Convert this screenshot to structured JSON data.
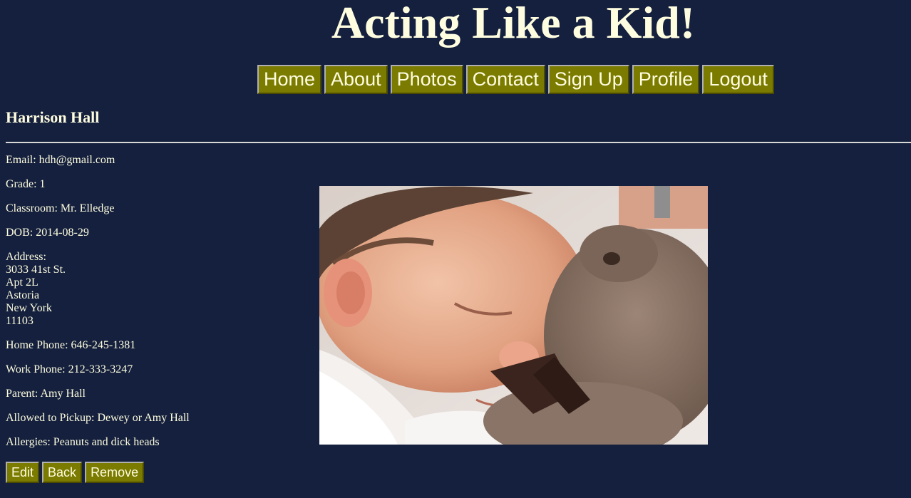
{
  "site": {
    "title": "Acting Like a Kid!"
  },
  "nav": {
    "items": [
      {
        "label": "Home"
      },
      {
        "label": "About"
      },
      {
        "label": "Photos"
      },
      {
        "label": "Contact"
      },
      {
        "label": "Sign Up"
      },
      {
        "label": "Profile"
      },
      {
        "label": "Logout"
      }
    ]
  },
  "profile": {
    "name": "Harrison Hall",
    "email": "Email: hdh@gmail.com",
    "grade": "Grade: 1",
    "classroom": "Classroom: Mr. Elledge",
    "dob": "DOB: 2014-08-29",
    "address_label": "Address:",
    "address_lines": [
      "3033 41st St.",
      "Apt 2L",
      "Astoria",
      "New York",
      "11103"
    ],
    "home_phone": "Home Phone: 646-245-1381",
    "work_phone": "Work Phone: 212-333-3247",
    "parent": "Parent: Amy Hall",
    "pickup": "Allowed to Pickup: Dewey or Amy Hall",
    "allergies": "Allergies: Peanuts and dick heads"
  },
  "actions": {
    "edit": "Edit",
    "back": "Back",
    "remove": "Remove"
  },
  "colors": {
    "background": "#14203d",
    "text": "#fffde0",
    "button": "#7b7b00"
  }
}
